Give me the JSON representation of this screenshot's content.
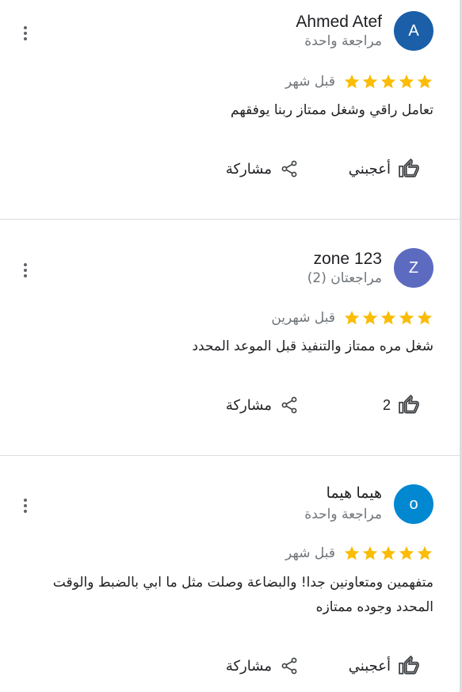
{
  "colors": {
    "star": "#fbbc04",
    "muted": "#70757a",
    "divider": "#dadce0"
  },
  "reviews": [
    {
      "avatar_letter": "A",
      "avatar_color": "#1a5fa8",
      "author": "Ahmed Atef",
      "review_count": "مراجعة واحدة",
      "rating": 5,
      "time": "قبل شهر",
      "text": "تعامل راقي وشغل ممتاز ربنا يوفقهم",
      "like_label": "أعجبني",
      "like_count": "",
      "share_label": "مشاركة"
    },
    {
      "avatar_letter": "Z",
      "avatar_color": "#5c6bc0",
      "author": "zone 123",
      "review_count": "مراجعتان (2)",
      "rating": 5,
      "time": "قبل شهرين",
      "text": "شغل مره ممتاز والتنفيذ قبل الموعد المحدد",
      "like_label": "",
      "like_count": "2",
      "share_label": "مشاركة"
    },
    {
      "avatar_letter": "o",
      "avatar_color": "#0288d1",
      "author": "هيما هيما",
      "review_count": "مراجعة واحدة",
      "rating": 5,
      "time": "قبل شهر",
      "text": "متفهمين ومتعاونين جدا! والبضاعة وصلت  مثل ما ابي بالضبط والوقت المحدد وجوده ممتازه",
      "like_label": "أعجبني",
      "like_count": "",
      "share_label": "مشاركة"
    }
  ]
}
